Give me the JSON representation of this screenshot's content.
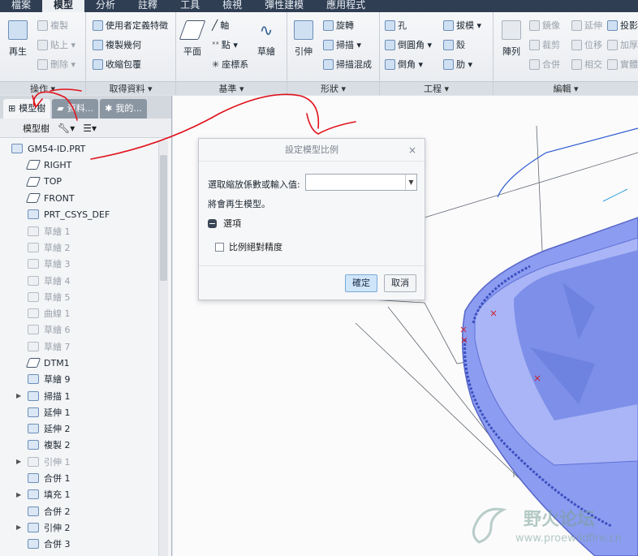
{
  "menu": {
    "tabs": [
      "檔案",
      "模型",
      "分析",
      "註釋",
      "工具",
      "檢視",
      "彈性建模",
      "應用程式"
    ],
    "active": "模型"
  },
  "ribbon": {
    "operations": {
      "label": "操作 ▾",
      "regen": "再生",
      "copy": "複製",
      "paste": "貼上 ▾",
      "delete": "刪除 ▾"
    },
    "get_data": {
      "label": "取得資料 ▾",
      "udf": "使用者定義特徵",
      "copy_geom": "複製幾何",
      "shrinkwrap": "收縮包覆"
    },
    "datum": {
      "label": "基準 ▾",
      "plane": "平面",
      "axis": "軸",
      "point": "點 ▾",
      "csys": "座標系",
      "sketch": "草繪"
    },
    "shapes": {
      "label": "形狀 ▾",
      "extrude": "引伸",
      "revolve": "旋轉",
      "sweep": "掃描 ▾",
      "swept_blend": "掃描混成"
    },
    "engineering": {
      "label": "工程 ▾",
      "hole": "孔",
      "round": "倒圓角 ▾",
      "chamfer": "倒角 ▾",
      "draft": "拔模 ▾",
      "shell": "殼",
      "rib": "肋 ▾"
    },
    "editing": {
      "label": "編輯 ▾",
      "pattern": "陣列",
      "mirror": "鏡像",
      "extend": "延伸",
      "project": "投影",
      "trim": "裁剪",
      "offset": "位移",
      "thicken": "加厚",
      "merge": "合併",
      "intersect": "相交",
      "solidify": "實體化"
    }
  },
  "panel": {
    "tabs": [
      "模型樹",
      "資料...",
      "我的..."
    ],
    "toolbar_label": "模型樹",
    "tree": [
      {
        "label": "GM54-ID.PRT",
        "icon": "part-icon",
        "root": true
      },
      {
        "label": "RIGHT",
        "icon": "datum-plane-icon"
      },
      {
        "label": "TOP",
        "icon": "datum-plane-icon"
      },
      {
        "label": "FRONT",
        "icon": "datum-plane-icon"
      },
      {
        "label": "PRT_CSYS_DEF",
        "icon": "csys-icon"
      },
      {
        "label": "草繪 1",
        "icon": "sketch-icon",
        "dim": true
      },
      {
        "label": "草繪 2",
        "icon": "sketch-icon",
        "dim": true
      },
      {
        "label": "草繪 3",
        "icon": "sketch-icon",
        "dim": true
      },
      {
        "label": "草繪 4",
        "icon": "sketch-icon",
        "dim": true
      },
      {
        "label": "草繪 5",
        "icon": "sketch-icon",
        "dim": true
      },
      {
        "label": "曲線 1",
        "icon": "curve-icon",
        "dim": true
      },
      {
        "label": "草繪 6",
        "icon": "sketch-icon",
        "dim": true
      },
      {
        "label": "草繪 7",
        "icon": "sketch-icon",
        "dim": true
      },
      {
        "label": "DTM1",
        "icon": "datum-plane-icon"
      },
      {
        "label": "草繪 9",
        "icon": "sketch-icon"
      },
      {
        "label": "掃描 1",
        "icon": "sweep-icon",
        "expandable": true
      },
      {
        "label": "延伸 1",
        "icon": "extend-icon"
      },
      {
        "label": "延伸 2",
        "icon": "extend-icon"
      },
      {
        "label": "複製 2",
        "icon": "copy-icon"
      },
      {
        "label": "引伸 1",
        "icon": "extrude-icon",
        "dim": true,
        "expandable": true
      },
      {
        "label": "合併 1",
        "icon": "merge-icon"
      },
      {
        "label": "填充 1",
        "icon": "fill-icon",
        "expandable": true
      },
      {
        "label": "合併 2",
        "icon": "merge-icon"
      },
      {
        "label": "引伸 2",
        "icon": "extrude-icon",
        "expandable": true
      },
      {
        "label": "合併 3",
        "icon": "merge-icon"
      }
    ]
  },
  "dialog": {
    "title": "設定模型比例",
    "prompt": "選取縮放係數或輸入值:",
    "value": "",
    "note": "將會再生模型。",
    "options_section": "選項",
    "checkbox_label": "比例絕對精度",
    "ok": "確定",
    "cancel": "取消"
  },
  "watermark": {
    "title": "野火论坛",
    "url": "www.proewildfire.cn"
  },
  "colors": {
    "model_fill": "#8c9cf0",
    "annotation": "#e0121b",
    "menubar": "#2f3e52"
  }
}
